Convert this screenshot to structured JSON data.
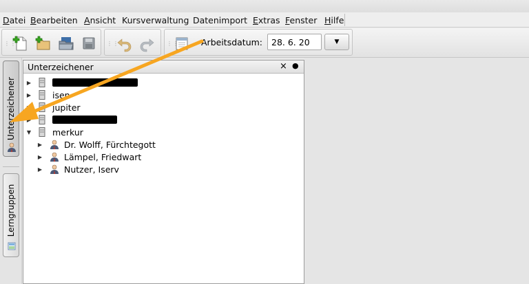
{
  "menu": {
    "items": [
      "Datei",
      "Bearbeiten",
      "Ansicht",
      "Kursverwaltung",
      "Datenimport",
      "Extras",
      "Fenster",
      "Hilfe"
    ],
    "mnemonic": [
      "D",
      "B",
      "A",
      "",
      "",
      "E",
      "F",
      "H"
    ]
  },
  "toolbar": {
    "icons": [
      "new-document-icon",
      "new-folder-icon",
      "open-folder-icon",
      "save-icon",
      "undo-icon",
      "redo-icon",
      "calendar-icon"
    ],
    "date_label": "Arbeitsdatum:",
    "date_value": "28. 6. 20",
    "dropdown_glyph": "▼"
  },
  "sidebar": {
    "tabs": [
      {
        "label": "Unterzeichener",
        "active": true
      },
      {
        "label": "Lerngruppen",
        "active": false
      }
    ]
  },
  "panel": {
    "title": "Unterzeichener",
    "close_glyph": "×",
    "pin_glyph": "●",
    "tree": [
      {
        "label": "",
        "type": "server",
        "expanded": false,
        "redacted": true
      },
      {
        "label": "isen",
        "type": "server",
        "expanded": false,
        "redacted": false
      },
      {
        "label": "jupiter",
        "type": "server",
        "expanded": false,
        "redacted": false
      },
      {
        "label": "",
        "type": "server",
        "expanded": false,
        "redacted": true
      },
      {
        "label": "merkur",
        "type": "server",
        "expanded": true,
        "redacted": false,
        "children": [
          {
            "label": "Dr. Wolff, Fürchtegott",
            "type": "person"
          },
          {
            "label": "Lämpel, Friedwart",
            "type": "person"
          },
          {
            "label": "Nutzer, Iserv",
            "type": "person"
          }
        ]
      }
    ]
  },
  "colors": {
    "arrow": "#f7a621",
    "accent_icon_green": "#38a820",
    "person_tie": "#c0392b"
  }
}
